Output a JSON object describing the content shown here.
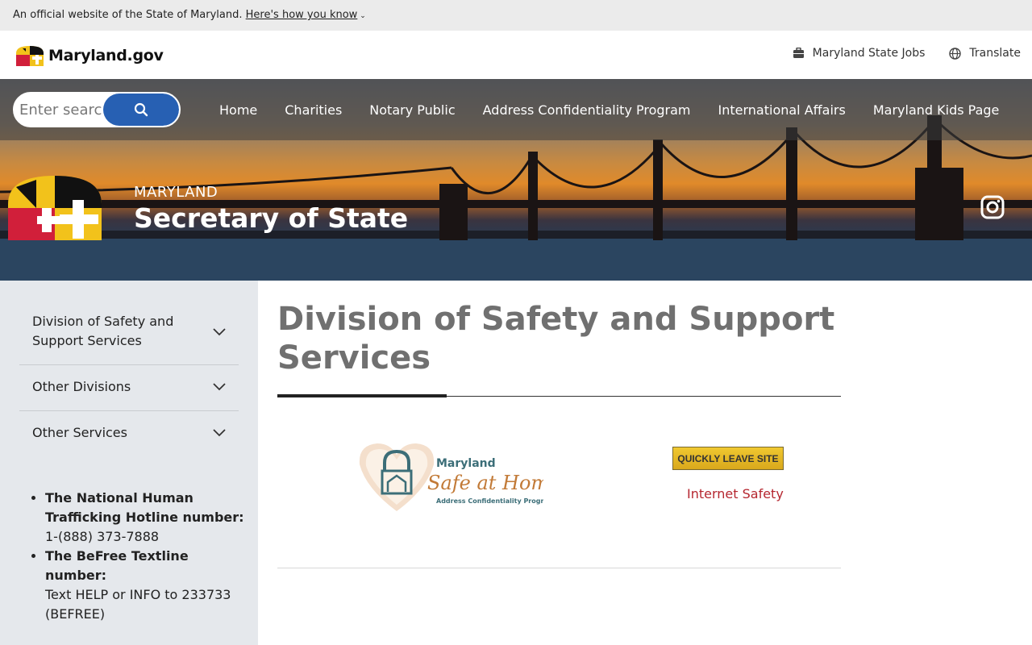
{
  "official_banner": {
    "text": "An official website of the State of Maryland.",
    "link": "Here's how you know"
  },
  "header": {
    "logo_text": "Maryland.gov",
    "links": [
      {
        "label": "Maryland State Jobs",
        "icon": "briefcase-icon"
      },
      {
        "label": "Translate",
        "icon": "globe-icon"
      }
    ]
  },
  "search": {
    "placeholder": "Enter search"
  },
  "nav": {
    "items": [
      "Home",
      "Charities",
      "Notary Public",
      "Address Confidentiality Program",
      "International Affairs",
      "Maryland Kids Page"
    ]
  },
  "agency": {
    "state": "MARYLAND",
    "title": "Secretary of State"
  },
  "sidebar": {
    "accordion": [
      {
        "label": "Division of Safety and Support Services"
      },
      {
        "label": "Other Divisions"
      },
      {
        "label": "Other Services"
      }
    ],
    "info": [
      {
        "bold": "The National Human Trafficking Hotline number:",
        "text": "1-(888) 373-7888"
      },
      {
        "bold": "The BeFree Textline number:",
        "text": "Text HELP or INFO to 233733 (BEFREE)"
      }
    ]
  },
  "main": {
    "title": "Division of Safety and Support Services",
    "safe_logo": {
      "line1": "Maryland",
      "line2": "Safe at Home",
      "line3": "Address Confidentiality Program"
    },
    "leave_button": "QUICKLY LEAVE SITE",
    "safety_link": "Internet Safety"
  },
  "colors": {
    "search_button": "#2760b3",
    "sidebar_bg": "#e5e8ec",
    "title_gray": "#707070",
    "link_red": "#b5262f",
    "leave_yellow": "#e6b826"
  }
}
